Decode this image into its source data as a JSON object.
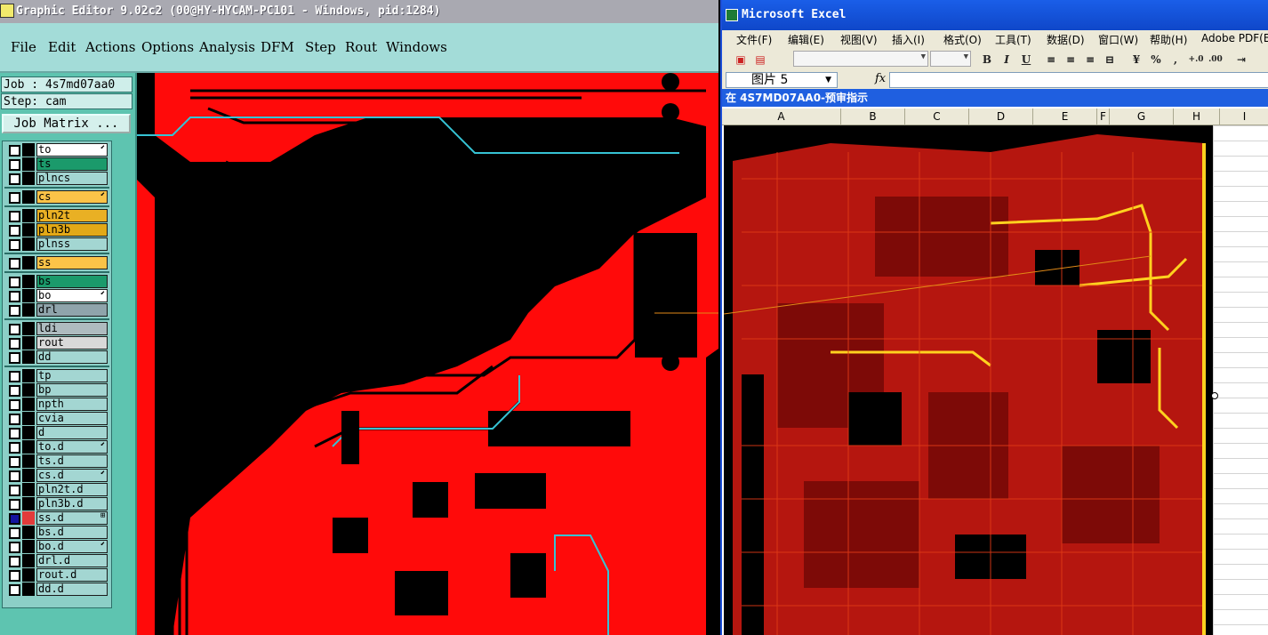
{
  "editor": {
    "title": "Graphic Editor 9.02c2 (00@HY-HYCAM-PC101 - Windows, pid:1284)",
    "menu": [
      "File",
      "Edit",
      "Actions",
      "Options",
      "Analysis",
      "DFM",
      "Step",
      "Rout",
      "Windows"
    ],
    "job_label": "Job : 4s7md07aa0",
    "step_label": "Step: cam",
    "job_matrix_button": "Job Matrix ...",
    "layers": [
      {
        "name": "to",
        "color": "#ffffff",
        "mark": "⬋"
      },
      {
        "name": "ts",
        "color": "#1b9a6b",
        "mark": ""
      },
      {
        "name": "plncs",
        "color": "#a3d6d2",
        "mark": ""
      },
      {
        "name": "cs",
        "color": "#fbc348",
        "mark": "⬋"
      },
      {
        "name": "pln2t",
        "color": "#e9b024",
        "mark": ""
      },
      {
        "name": "pln3b",
        "color": "#e2a917",
        "mark": ""
      },
      {
        "name": "plnss",
        "color": "#a3d6d2",
        "mark": ""
      },
      {
        "name": "ss",
        "color": "#fbc348",
        "mark": ""
      },
      {
        "name": "bs",
        "color": "#1b9a6b",
        "mark": ""
      },
      {
        "name": "bo",
        "color": "#ffffff",
        "mark": "⬋"
      },
      {
        "name": "drl",
        "color": "#8fa4ab",
        "mark": ""
      },
      {
        "name": "ldi",
        "color": "#aebbbf",
        "mark": ""
      },
      {
        "name": "rout",
        "color": "#d9d9d9",
        "mark": ""
      },
      {
        "name": "dd",
        "color": "#a3d6d2",
        "mark": ""
      },
      {
        "name": "tp",
        "color": "#a3d6d2",
        "mark": ""
      },
      {
        "name": "bp",
        "color": "#a3d6d2",
        "mark": ""
      },
      {
        "name": "npth",
        "color": "#a3d6d2",
        "mark": ""
      },
      {
        "name": "cvia",
        "color": "#a3d6d2",
        "mark": ""
      },
      {
        "name": "d",
        "color": "#a3d6d2",
        "mark": ""
      },
      {
        "name": "to.d",
        "color": "#a3d6d2",
        "mark": "⬋"
      },
      {
        "name": "ts.d",
        "color": "#a3d6d2",
        "mark": ""
      },
      {
        "name": "cs.d",
        "color": "#a3d6d2",
        "mark": "⬋"
      },
      {
        "name": "pln2t.d",
        "color": "#a3d6d2",
        "mark": ""
      },
      {
        "name": "pln3b.d",
        "color": "#a3d6d2",
        "mark": ""
      },
      {
        "name": "ss.d",
        "color": "#a3d6d2",
        "mark": "⊞",
        "active": true
      },
      {
        "name": "bs.d",
        "color": "#a3d6d2",
        "mark": ""
      },
      {
        "name": "bo.d",
        "color": "#a3d6d2",
        "mark": "⬋"
      },
      {
        "name": "drl.d",
        "color": "#a3d6d2",
        "mark": ""
      },
      {
        "name": "rout.d",
        "color": "#a3d6d2",
        "mark": ""
      },
      {
        "name": "dd.d",
        "color": "#a3d6d2",
        "mark": ""
      }
    ],
    "canvas_colors": {
      "copper": "#ff0a0a",
      "background": "#000000",
      "highlight": "#36c3d4"
    }
  },
  "excel": {
    "title": "Microsoft Excel",
    "menu": [
      "文件(F)",
      "编辑(E)",
      "视图(V)",
      "插入(I)",
      "格式(O)",
      "工具(T)",
      "数据(D)",
      "窗口(W)",
      "帮助(H)",
      "Adobe PDF(B)"
    ],
    "name_box": "图片 5",
    "fx_label": "fx",
    "doc_title": "在 4S7MD07AA0-预审指示",
    "columns": [
      "A",
      "B",
      "C",
      "D",
      "E",
      "F",
      "G",
      "H",
      "I"
    ],
    "toolbar_labels": {
      "bold": "B",
      "italic": "I",
      "underline": "U",
      "percent": "%",
      "comma": ","
    }
  }
}
